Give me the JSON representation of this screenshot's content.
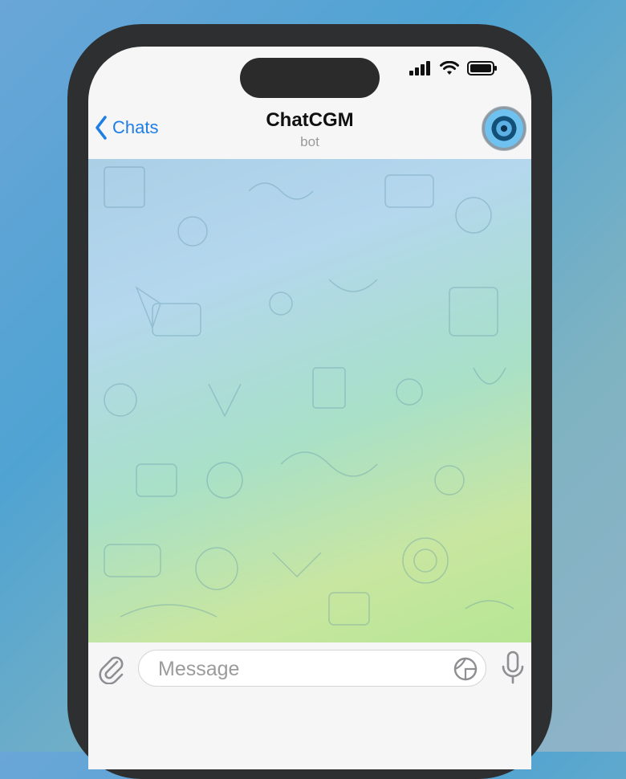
{
  "nav": {
    "back_label": "Chats"
  },
  "chat": {
    "title": "ChatCGM",
    "subtitle": "bot"
  },
  "composer": {
    "placeholder": "Message"
  },
  "colors": {
    "accent": "#1f7ee6",
    "background": "#f6f6f6"
  },
  "icons": {
    "back": "chevron-left-icon",
    "attach": "paperclip-icon",
    "sticker": "sticker-icon",
    "mic": "microphone-icon",
    "signal": "signal-icon",
    "wifi": "wifi-icon",
    "battery": "battery-icon"
  }
}
